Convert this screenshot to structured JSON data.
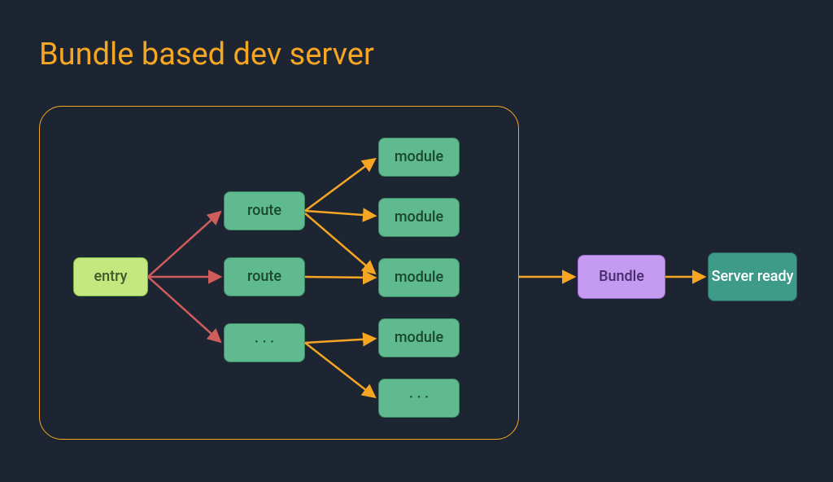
{
  "title": "Bundle based dev server",
  "nodes": {
    "entry": "entry",
    "route1": "route",
    "route2": "route",
    "route3": "· · ·",
    "module1": "module",
    "module2": "module",
    "module3": "module",
    "module4": "module",
    "module5": "· · ·",
    "bundle": "Bundle",
    "server": "Server ready"
  },
  "colors": {
    "accent": "#f5a623",
    "arrow_red": "#d15c5c",
    "arrow_orange": "#f5a623"
  }
}
